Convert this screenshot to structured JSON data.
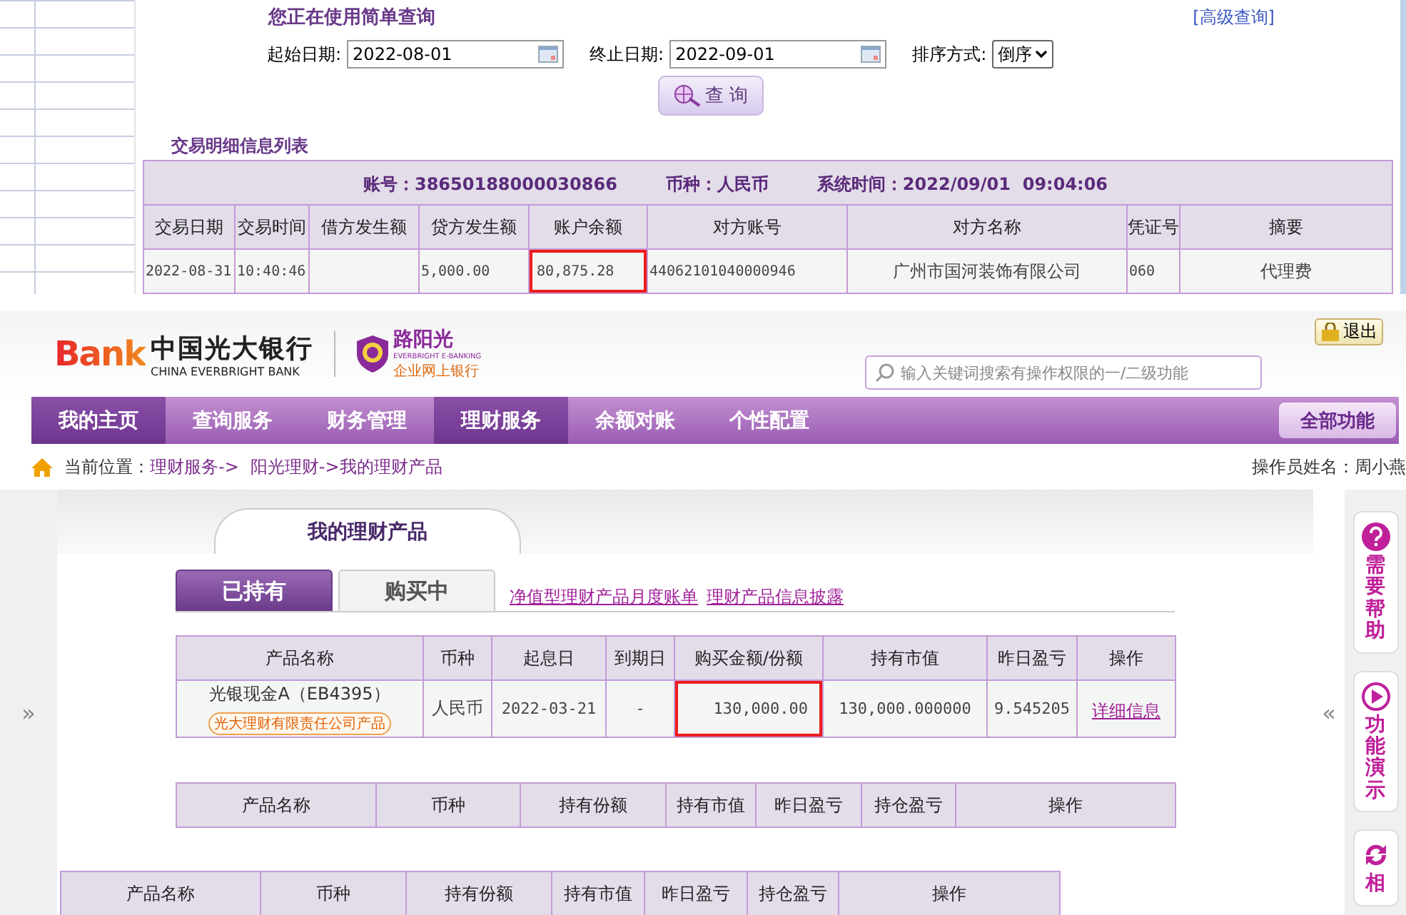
{
  "query_panel": {
    "title": "您正在使用简单查询",
    "advanced_link": "[高级查询]",
    "date_fields": [
      {
        "label": "起始日期:",
        "value": "2022-08-01"
      },
      {
        "label": "终止日期:",
        "value": "2022-09-01"
      }
    ],
    "sort": {
      "label": "排序方式:",
      "value": "倒序"
    },
    "query_button": "查 询"
  },
  "transactions": {
    "title": "交易明细信息列表",
    "summary": [
      "账号：38650188000030866",
      "币种：人民币",
      "系统时间：2022/09/01  09:04:06"
    ],
    "columns": [
      "交易日期",
      "交易时间",
      "借方发生额",
      "贷方发生额",
      "账户余额",
      "对方账号",
      "对方名称",
      "凭证号",
      "摘要"
    ],
    "rows": [
      {
        "cells": [
          {
            "text": "2022-08-31",
            "highlighted": false
          },
          {
            "text": "10:40:46",
            "highlighted": false
          },
          {
            "highlighted": false
          },
          {
            "text": "5,000.00",
            "highlighted": false
          },
          {
            "text": "80,875.28",
            "highlighted": true
          },
          {
            "text": "44062101040000946",
            "highlighted": false
          },
          {
            "text": "广州市国河装饰有限公司",
            "highlighted": false
          },
          {
            "text": "060",
            "highlighted": false
          },
          {
            "text": "代理费",
            "highlighted": false
          }
        ]
      }
    ]
  },
  "bank_header": {
    "logo_mark": "Bank",
    "bank_name": "中国光大银行",
    "bank_name_en": "CHINA EVERBRIGHT BANK",
    "sub_brand": "路阳光",
    "sub_brand_en": "EVERBRIGHT E-BANKING",
    "sub_brand_caption": "企业网上银行",
    "exit_button": "退出",
    "search": {
      "placeholder": "输入关键词搜索有操作权限的一/二级功能"
    }
  },
  "nav": {
    "items": [
      {
        "label": "我的主页",
        "selected": true
      },
      {
        "label": "查询服务",
        "selected": false
      },
      {
        "label": "财务管理",
        "selected": false
      },
      {
        "label": "理财服务",
        "selected": true
      },
      {
        "label": "余额对账",
        "selected": false
      },
      {
        "label": "个性配置",
        "selected": false
      }
    ],
    "all_functions": "全部功能"
  },
  "breadcrumb": {
    "prefix": "当前位置：",
    "links": [
      "理财服务->",
      "阳光理财->我的理财产品"
    ],
    "operator": "操作员姓名：周小燕"
  },
  "products": {
    "title": "我的理财产品",
    "tabs": [
      {
        "label": "已持有",
        "selected": true
      },
      {
        "label": "购买中",
        "selected": false
      }
    ],
    "links": [
      "净值型理财产品月度账单",
      "理财产品信息披露"
    ],
    "held_table": {
      "columns": [
        "产品名称",
        "币种",
        "起息日",
        "到期日",
        "购买金额/份额",
        "持有市值",
        "昨日盈亏",
        "操作"
      ],
      "rows": [
        {
          "cells": [
            {
              "kind": "product",
              "text": "光银现金A（EB4395）",
              "tag": "光大理财有限责任公司产品",
              "highlighted": false
            },
            {
              "kind": "text",
              "text": "人民币",
              "highlighted": false
            },
            {
              "kind": "number",
              "text": "2022-03-21",
              "highlighted": false
            },
            {
              "kind": "number",
              "text": "-",
              "highlighted": false
            },
            {
              "kind": "amount",
              "text": "130,000.00",
              "highlighted": true
            },
            {
              "kind": "number",
              "text": "130,000.000000",
              "highlighted": false
            },
            {
              "kind": "number",
              "text": "9.545205",
              "highlighted": false
            },
            {
              "kind": "link",
              "text": "详细信息",
              "highlighted": false
            }
          ]
        }
      ]
    },
    "table_2": {
      "columns": [
        "产品名称",
        "币种",
        "持有份额",
        "持有市值",
        "昨日盈亏",
        "持仓盈亏",
        "操作"
      ]
    },
    "table_3": {
      "columns": [
        "产品名称",
        "币种",
        "持有份额",
        "持有市值",
        "昨日盈亏",
        "持仓盈亏",
        "操作"
      ]
    },
    "expand_left": "»",
    "collapse_right": "«"
  },
  "side_tools": [
    {
      "kind": "help",
      "label": "需要帮助"
    },
    {
      "kind": "demo",
      "label": "功能演示"
    },
    {
      "kind": "refresh",
      "label": "相"
    }
  ]
}
